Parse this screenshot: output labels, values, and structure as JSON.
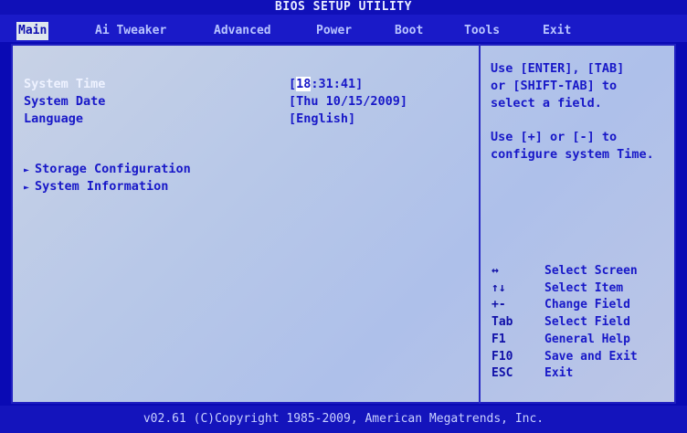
{
  "title": "BIOS SETUP UTILITY",
  "menu": [
    {
      "label": "Main"
    },
    {
      "label": "Ai Tweaker"
    },
    {
      "label": "Advanced"
    },
    {
      "label": "Power"
    },
    {
      "label": "Boot"
    },
    {
      "label": "Tools"
    },
    {
      "label": "Exit"
    }
  ],
  "main": {
    "system_time_label": "System Time",
    "system_time_value_open": "[",
    "system_time_value_cursor": "18",
    "system_time_value_rest": ":31:41]",
    "system_date_label": "System Date",
    "system_date_value": "[Thu 10/15/2009]",
    "language_label": "Language",
    "language_value": "[English]",
    "submenus": [
      {
        "arrow": "►",
        "label": "Storage Configuration"
      },
      {
        "arrow": "►",
        "label": "System Information"
      }
    ]
  },
  "help": {
    "line1": "Use [ENTER], [TAB]",
    "line2": "or [SHIFT-TAB] to",
    "line3": "select a field.",
    "line4": "Use [+] or [-] to",
    "line5": "configure system Time."
  },
  "keys": [
    {
      "key": "↔",
      "desc": "Select Screen"
    },
    {
      "key": "↑↓",
      "desc": "Select Item"
    },
    {
      "key": "+-",
      "desc": "Change Field"
    },
    {
      "key": "Tab",
      "desc": "Select Field"
    },
    {
      "key": "F1",
      "desc": "General Help"
    },
    {
      "key": "F10",
      "desc": "Save and Exit"
    },
    {
      "key": "ESC",
      "desc": "Exit"
    }
  ],
  "footer": "v02.61 (C)Copyright 1985-2009, American Megatrends, Inc."
}
